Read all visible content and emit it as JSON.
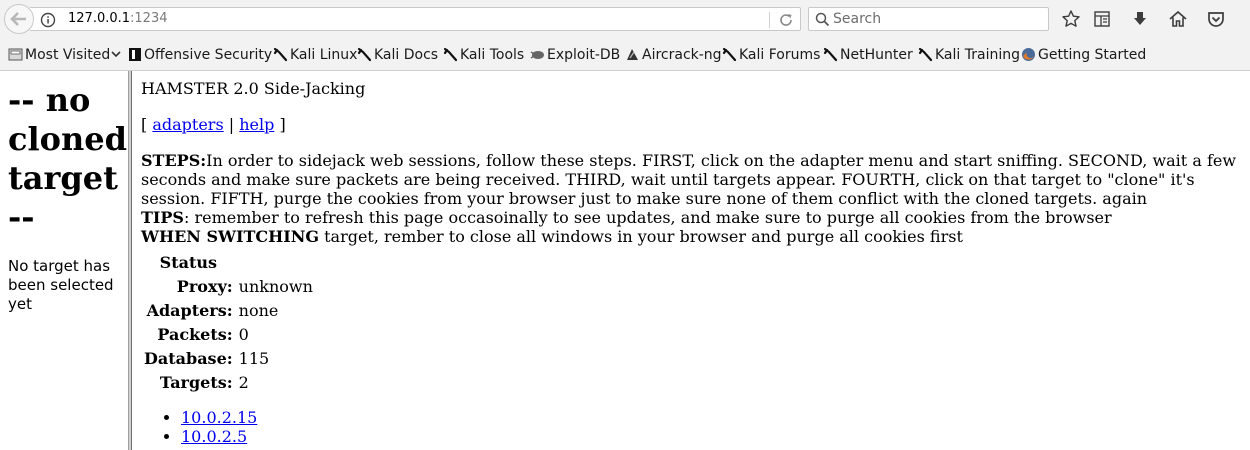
{
  "browser": {
    "url_host": "127.0.0.1",
    "url_port": ":1234",
    "search_placeholder": "Search",
    "bookmarks": [
      {
        "label": "Most Visited",
        "icon": "folder-icon"
      },
      {
        "label": "Offensive Security",
        "icon": "offsec-icon"
      },
      {
        "label": "Kali Linux",
        "icon": "kali-dragon-icon"
      },
      {
        "label": "Kali Docs",
        "icon": "kali-dragon-icon"
      },
      {
        "label": "Kali Tools",
        "icon": "kali-dragon-icon"
      },
      {
        "label": "Exploit-DB",
        "icon": "exploit-db-icon"
      },
      {
        "label": "Aircrack-ng",
        "icon": "aircrack-icon"
      },
      {
        "label": "Kali Forums",
        "icon": "kali-dragon-icon"
      },
      {
        "label": "NetHunter",
        "icon": "kali-dragon-icon"
      },
      {
        "label": "Kali Training",
        "icon": "kali-dragon-icon"
      },
      {
        "label": "Getting Started",
        "icon": "firefox-icon"
      }
    ]
  },
  "left": {
    "title": "-- no cloned target --",
    "message": "No target has been selected yet"
  },
  "right": {
    "title": "HAMSTER 2.0 Side-Jacking",
    "nav_open": "[",
    "nav_adapters": "adapters",
    "nav_sep": "|",
    "nav_help": "help",
    "nav_close": "]",
    "steps_label": "STEPS:",
    "steps_text": "In order to sidejack web sessions, follow these steps. FIRST, click on the adapter menu and start sniffing. SECOND, wait a few seconds and make sure packets are being received. THIRD, wait until targets appear. FOURTH, click on that target to \"clone\" it's session. FIFTH, purge the cookies from your browser just to make sure none of them conflict with the cloned targets. again",
    "tips_label": "TIPS",
    "tips_text": ": remember to refresh this page occasoinally to see updates, and make sure to purge all cookies from the browser",
    "switch_label": "WHEN SWITCHING",
    "switch_text": " target, rember to close all windows in your browser and purge all cookies first",
    "status": {
      "header": "Status",
      "rows": [
        {
          "label": "Proxy:",
          "value": "unknown"
        },
        {
          "label": "Adapters:",
          "value": "none"
        },
        {
          "label": "Packets:",
          "value": "0"
        },
        {
          "label": "Database:",
          "value": "115"
        },
        {
          "label": "Targets:",
          "value": "2"
        }
      ]
    },
    "targets": [
      "10.0.2.15",
      "10.0.2.5"
    ]
  }
}
